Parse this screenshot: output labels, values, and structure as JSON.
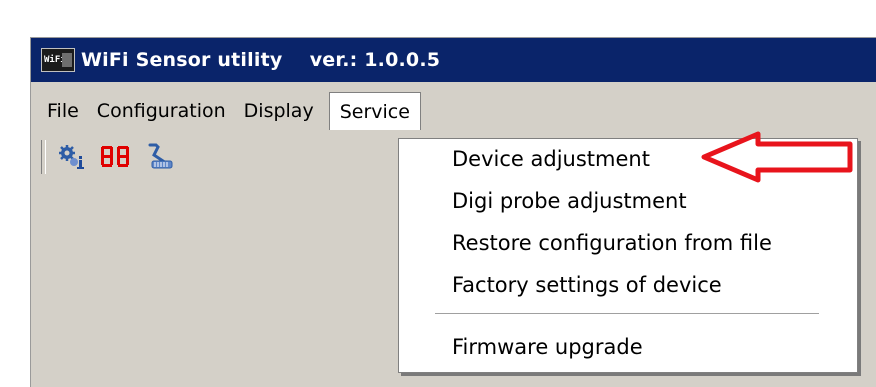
{
  "window": {
    "title": "WiFi Sensor utility    ver.: 1.0.0.5",
    "app_icon_text": "WiFi"
  },
  "menubar": {
    "items": [
      {
        "label": "File"
      },
      {
        "label": "Configuration"
      },
      {
        "label": "Display"
      },
      {
        "label": "Service"
      }
    ]
  },
  "toolbar": {
    "buttons": [
      {
        "icon": "device-info-icon"
      },
      {
        "icon": "digital-display-icon",
        "text": "88"
      },
      {
        "icon": "probe-icon"
      }
    ]
  },
  "service_menu": {
    "items": [
      {
        "label": "Device adjustment"
      },
      {
        "label": "Digi probe adjustment"
      },
      {
        "label": "Restore configuration from file"
      },
      {
        "label": "Factory settings of device"
      },
      {
        "label": "Firmware upgrade"
      }
    ]
  },
  "colors": {
    "titlebar": "#0a246a",
    "window_bg": "#d4d0c8",
    "arrow": "#e8141c",
    "display_digits": "#e00000"
  }
}
